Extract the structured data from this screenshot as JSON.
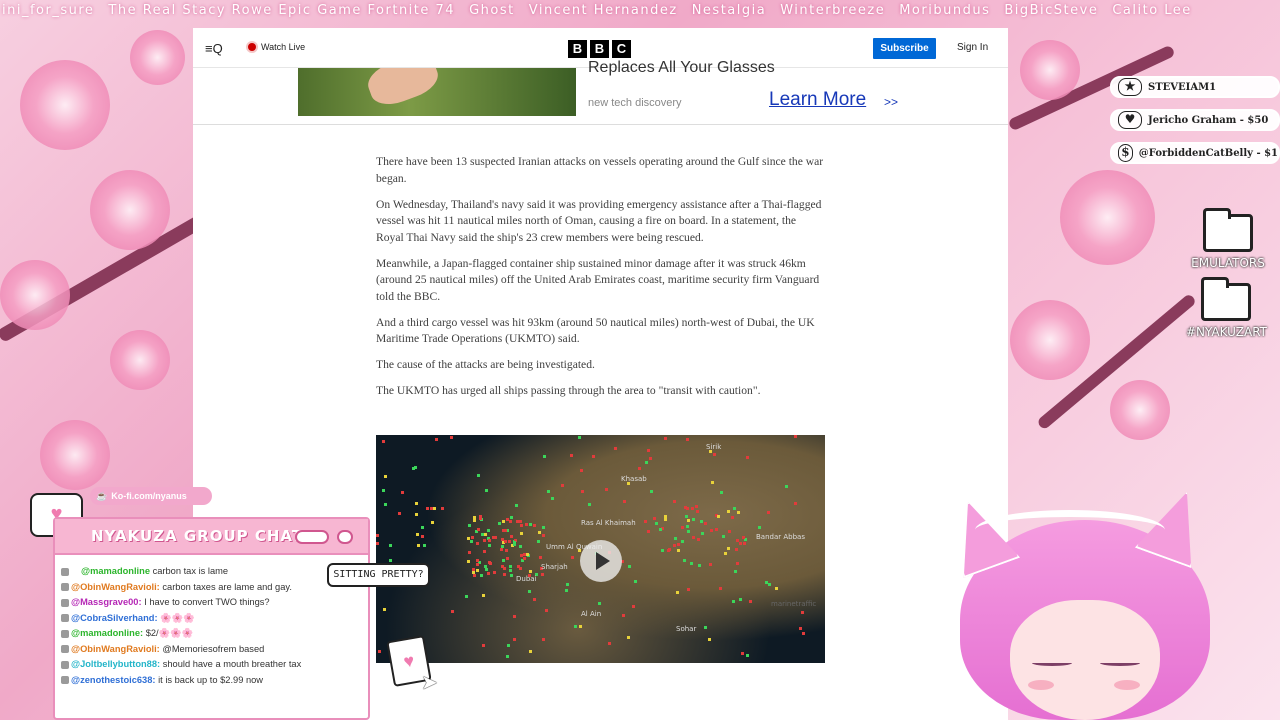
{
  "ticker": [
    "ini_for_sure",
    "The Real Stacy Rowe Epic Game Fortnite 74",
    "Ghost",
    "Vincent Hernandez",
    "Nestalgia",
    "Winterbreeze",
    "Moribundus",
    "BigBicSteve",
    "Calito Lee"
  ],
  "browser": {
    "header": {
      "menu_label": "≡Q",
      "watch_live": "Watch Live",
      "logo": [
        "B",
        "B",
        "C"
      ],
      "subscribe": "Subscribe",
      "signin": "Sign In"
    },
    "ad": {
      "headline": "Replaces All Your Glasses",
      "sub": "new tech discovery",
      "cta": "Learn More",
      "cta_arrow": ">>"
    },
    "article": {
      "paragraphs": [
        "There have been 13 suspected Iranian attacks on vessels operating around the Gulf since the war began.",
        "On Wednesday, Thailand's navy said it was providing emergency assistance after a Thai-flagged vessel was hit 11 nautical miles north of Oman, causing a fire on board. In a statement, the Royal Thai Navy said the ship's 23 crew members were being rescued.",
        "Meanwhile, a Japan-flagged container ship sustained minor damage after it was struck 46km (around 25 nautical miles) off the United Arab Emirates coast, maritime security firm Vanguard told the BBC.",
        "And a third cargo vessel was hit 93km (around 50 nautical miles) north-west of Dubai, the UK Maritime Trade Operations (UKMTO) said.",
        "The cause of the attacks are being investigated.",
        "The UKMTO has urged all ships passing through the area to \"transit with caution\"."
      ]
    },
    "video": {
      "labels": [
        "Khasab",
        "Ras Al Khaimah",
        "Umm Al Quwain",
        "Dubai",
        "Sharjah",
        "Bandar Abbas",
        "Al Ain",
        "Sohar",
        "Sirik",
        "marinetraffic"
      ]
    }
  },
  "recent_events": [
    {
      "icon": "★",
      "text": "STEVEIAM1"
    },
    {
      "icon": "♥",
      "text": "Jericho Graham - $50"
    },
    {
      "icon": "$",
      "text": "@ForbiddenCatBelly - $1"
    }
  ],
  "folders": [
    "EMULATORS",
    "#NYAKUZART"
  ],
  "kofi": "Ko-fi.com/nyanus",
  "chat": {
    "title": "NYAKUZA GROUP CHAT",
    "messages": [
      {
        "user": "@mamadonline",
        "text": "carbon tax is lame",
        "color": "#2db52d"
      },
      {
        "user": "@ObinWangRavioli:",
        "text": "carbon taxes are lame and gay.",
        "color": "#e07a1f"
      },
      {
        "user": "@Massgrave00:",
        "text": "I have to convert TWO things?",
        "color": "#b526b5"
      },
      {
        "user": "@CobraSilverhand:",
        "text": "🌸🌸🌸",
        "color": "#2f6fd6"
      },
      {
        "user": "@mamadonline:",
        "text": "$2/🌸🌸🌸",
        "color": "#2db52d"
      },
      {
        "user": "@ObinWangRavioli:",
        "text": "@Memoriesofrem based",
        "color": "#e07a1f"
      },
      {
        "user": "@Joltbellybutton88:",
        "text": "should have a mouth breather tax",
        "color": "#24b5c9"
      },
      {
        "user": "@zenothestoic638:",
        "text": "it is back up to $2.99 now",
        "color": "#2f6fd6"
      }
    ]
  },
  "bubble": "SITTING PRETTY?",
  "colors": {
    "accent_pink": "#f7b6d2",
    "bbc_blue": "#0068d6",
    "live_red": "#cc0000"
  }
}
